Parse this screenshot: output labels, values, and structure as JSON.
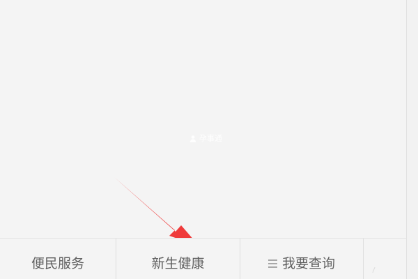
{
  "watermark": {
    "icon": "user-icon",
    "text": "孕事通"
  },
  "annotation": {
    "icon": "red-arrow-icon",
    "color": "#ef3b3b"
  },
  "bottom_nav": {
    "items": [
      {
        "label": "便民服务"
      },
      {
        "label": "新生健康"
      },
      {
        "label": "我要查询",
        "icon": "menu-icon"
      },
      {
        "label": ""
      }
    ]
  },
  "colors": {
    "background": "#f4f4f4",
    "nav_text": "#5f5f5f",
    "divider": "#dddddd",
    "watermark": "#ffffff"
  }
}
